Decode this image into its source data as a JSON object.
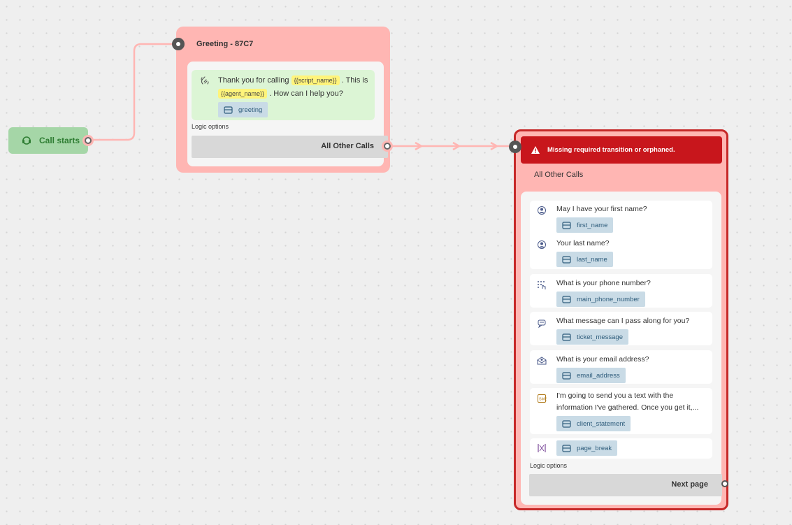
{
  "start_node": {
    "label": "Call starts"
  },
  "greeting_node": {
    "title": "Greeting - 87C7",
    "message": {
      "part1": "Thank you for calling ",
      "token1": "{{script_name}}",
      "part2": " . This is ",
      "token2": "{{agent_name}}",
      "part3": " . How can I help you?"
    },
    "variable": "greeting",
    "logic_label": "Logic options",
    "transition_button": "All Other Calls"
  },
  "question_node": {
    "warning": "Missing required transition or orphaned.",
    "title": "All Other Calls",
    "cards": [
      {
        "items": [
          {
            "icon": "person-icon",
            "question": "May I have your first name?",
            "variable": "first_name"
          },
          {
            "icon": "person-icon",
            "question": "Your last name?",
            "variable": "last_name"
          }
        ]
      },
      {
        "items": [
          {
            "icon": "dialpad-icon",
            "question": "What is your phone number?",
            "variable": "main_phone_number"
          }
        ]
      },
      {
        "items": [
          {
            "icon": "message-icon",
            "question": "What message can I pass along for you?",
            "variable": "ticket_message"
          }
        ]
      },
      {
        "items": [
          {
            "icon": "email-icon",
            "question": "What is your email address?",
            "variable": "email_address"
          }
        ]
      },
      {
        "items": [
          {
            "icon": "text-sms-icon",
            "question": "I'm going to send you a text with the information I've gathered. Once you get it,...",
            "variable": "client_statement"
          }
        ]
      },
      {
        "items": [
          {
            "icon": "page-break-icon",
            "question": "",
            "variable": "page_break"
          }
        ]
      }
    ],
    "logic_label": "Logic options",
    "next_button": "Next page"
  },
  "colors": {
    "node_bg": "#ffb6b3",
    "error": "#c8161c",
    "start_bg": "#a5d6a7",
    "message_bg": "#dcf5d5",
    "token_bg": "#fff47a",
    "chip_bg": "#c9dbe6"
  }
}
